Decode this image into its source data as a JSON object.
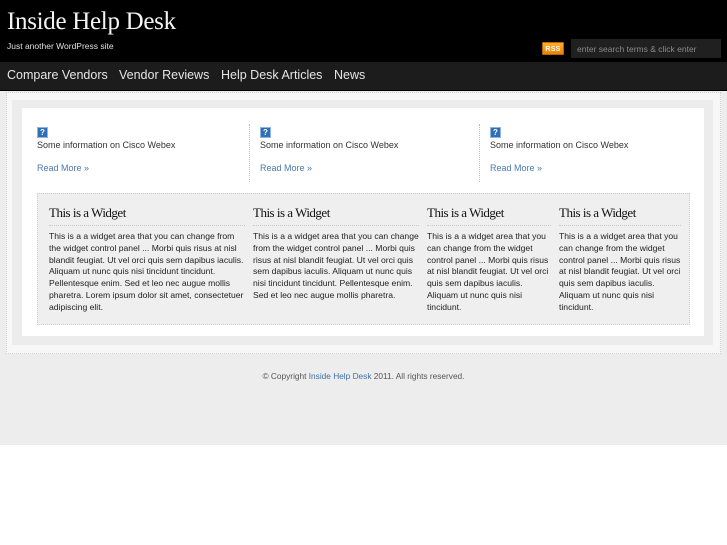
{
  "header": {
    "site_title": "Inside Help Desk",
    "tagline": "Just another WordPress site",
    "rss_label": "RSS",
    "search_placeholder": "enter search terms & click enter",
    "search_value": ""
  },
  "nav": {
    "items": [
      {
        "label": "Compare Vendors"
      },
      {
        "label": "Vendor Reviews"
      },
      {
        "label": "Help Desk Articles"
      },
      {
        "label": "News"
      }
    ]
  },
  "features": [
    {
      "icon": "help-icon",
      "icon_glyph": "?",
      "text": "Some information on Cisco Webex",
      "link": "Read More »"
    },
    {
      "icon": "help-icon",
      "icon_glyph": "?",
      "text": "Some information on Cisco Webex",
      "link": "Read More »"
    },
    {
      "icon": "help-icon",
      "icon_glyph": "?",
      "text": "Some information on Cisco Webex",
      "link": "Read More »"
    }
  ],
  "widgets": [
    {
      "title": "This is a Widget",
      "body": "This is a a widget area that you can change from the widget control panel ... Morbi quis risus at nisl blandit feugiat. Ut vel orci quis sem dapibus iaculis. Aliquam ut nunc quis nisi tincidunt tincidunt. Pellentesque enim. Sed et leo nec augue mollis pharetra. Lorem ipsum dolor sit amet, consectetuer adipiscing elit."
    },
    {
      "title": "This is a Widget",
      "body": "This is a a widget area that you can change from the widget control panel ... Morbi quis risus at nisl blandit feugiat. Ut vel orci quis sem dapibus iaculis. Aliquam ut nunc quis nisi tincidunt tincidunt. Pellentesque enim. Sed et leo nec augue mollis pharetra."
    },
    {
      "title": "This is a Widget",
      "body": "This is a a widget area that you can change from the widget control panel ... Morbi quis risus at nisl blandit feugiat. Ut vel orci quis sem dapibus iaculis. Aliquam ut nunc quis nisi tincidunt."
    },
    {
      "title": "This is a Widget",
      "body": "This is a a widget area that you can change from the widget control panel ... Morbi quis risus at nisl blandit feugiat. Ut vel orci quis sem dapibus iaculis. Aliquam ut nunc quis nisi tincidunt."
    }
  ],
  "footer": {
    "prefix": "© Copyright ",
    "link": "Inside Help Desk",
    "suffix": " 2011. All rights reserved."
  },
  "colors": {
    "rss": "#f39a1e",
    "link": "#4a79b0",
    "header_bg": "#000000",
    "nav_bg": "#1c1c1c"
  }
}
